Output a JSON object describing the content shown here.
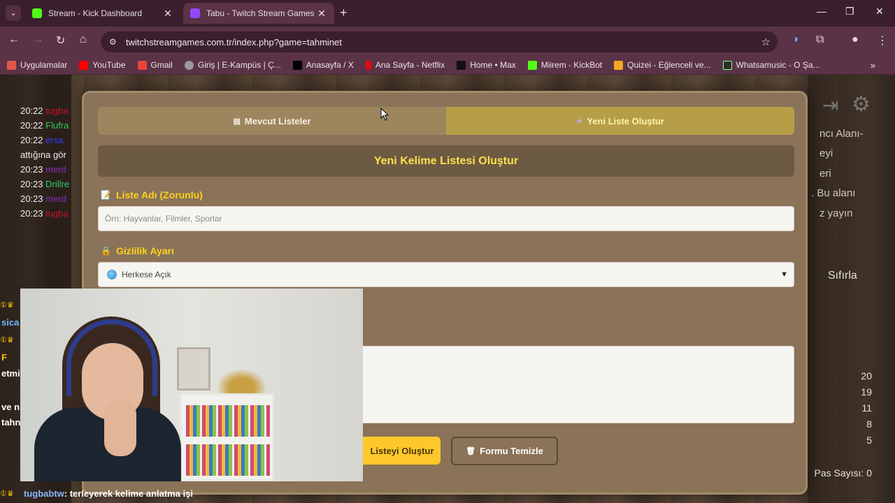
{
  "browser": {
    "tabs": [
      {
        "title": "Stream - Kick Dashboard",
        "favicon_color": "#53fc18"
      },
      {
        "title": "Tabu - Twitch Stream Games",
        "favicon_color": "#9146ff"
      }
    ],
    "url": "twitchstreamgames.com.tr/index.php?game=tahminet",
    "bookmarks": [
      {
        "label": "Uygulamalar",
        "icon_color": "#e0584a"
      },
      {
        "label": "YouTube",
        "icon_color": "#ff0000"
      },
      {
        "label": "Gmail",
        "icon_color": "#ea4335"
      },
      {
        "label": "Giriş | E-Kampüs | Ç...",
        "icon_color": "#9a9a9a"
      },
      {
        "label": "Anasayfa / X",
        "icon_color": "#000000"
      },
      {
        "label": "Ana Sayfa - Netflix",
        "icon_color": "#e50914"
      },
      {
        "label": "Home • Max",
        "icon_color": "#111111"
      },
      {
        "label": "Miirem - KickBot",
        "icon_color": "#53fc18"
      },
      {
        "label": "Quizei - Eğlenceli ve...",
        "icon_color": "#f5a623"
      },
      {
        "label": "Whatsamusic - O Şa...",
        "icon_color": "#2c2c2c"
      }
    ]
  },
  "chat": {
    "lines": [
      {
        "time": "20:22",
        "name": "tugba",
        "color": "#c8102e"
      },
      {
        "time": "20:22",
        "name": "Flufra",
        "color": "#34c759"
      },
      {
        "time": "20:22",
        "name": "ersa",
        "color": "#3a3aff"
      },
      {
        "time": "",
        "name": "attığına gör",
        "color": "#eeeeee"
      },
      {
        "time": "20:23",
        "name": "merd",
        "color": "#8e2bb8"
      },
      {
        "time": "20:23",
        "name": "Drillre",
        "color": "#2ecc71"
      },
      {
        "time": "20:23",
        "name": "merd",
        "color": "#8e2bb8"
      },
      {
        "time": "20:23",
        "name": "tugba",
        "color": "#c8102e"
      }
    ],
    "left_snippets": [
      "sica",
      "F",
      "etmi",
      "ve n",
      "tahn"
    ],
    "bottom_user": "tugbabtw",
    "bottom_message": ": terleyerek kelime anlatma işi"
  },
  "right_panel": {
    "snippets": [
      "ncı Alanı-",
      "eyi",
      "eri",
      ". Bu alanı",
      "z yayın"
    ],
    "reset_label": "Sıfırla",
    "scores": [
      "20",
      "19",
      "11",
      "8",
      "5"
    ],
    "pass_count": "Pas Sayısı: 0"
  },
  "modal": {
    "tab_lists": "Mevcut Listeler",
    "tab_new": "Yeni Liste Oluştur",
    "heading": "Yeni Kelime Listesi Oluştur",
    "name_label": "Liste Adı (Zorunlu)",
    "name_placeholder": "Örn: Hayvanlar, Filmler, Sporlar",
    "privacy_label": "Gizlilik Ayarı",
    "privacy_value": "Herkese Açık",
    "create_button": "Listeyi Oluştur",
    "clear_button": "Formu Temizle"
  }
}
